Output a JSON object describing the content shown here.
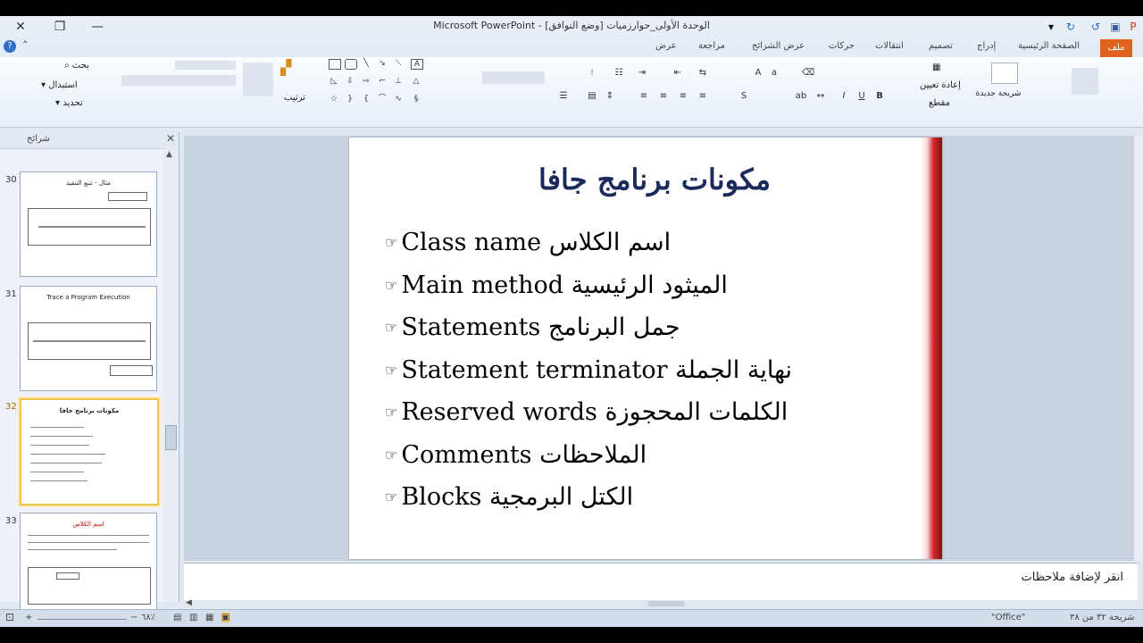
{
  "window": {
    "title": "Microsoft PowerPoint - [وضع التوافق] الوحدة الأولى_حوارزميات"
  },
  "ribbon": {
    "tabs": [
      "ملف",
      "الصفحة الرئيسية",
      "إدراج",
      "تصميم",
      "انتقالات",
      "حركات",
      "عرض الشرائح",
      "مراجعة",
      "عرض"
    ],
    "editing": {
      "find": "بحث",
      "replace": "استبدال",
      "select": "تحديد"
    },
    "arrange": "ترتيب",
    "slides": {
      "new_slide": "شريحة جديدة",
      "reset": "إعادة تعيين",
      "section": "مقطع"
    }
  },
  "slide_pane": {
    "header": "شرائح",
    "thumbnails": [
      {
        "number": "30",
        "title": "مثال - تتبع التنفيذ",
        "selected": false
      },
      {
        "number": "31",
        "title": "Trace a Program Execution",
        "selected": false
      },
      {
        "number": "32",
        "title": "مكونات برنامج جافا",
        "selected": true
      },
      {
        "number": "33",
        "title": "اسم الكلاس",
        "selected": false
      }
    ]
  },
  "slide": {
    "title": "مكونات برنامج جافا",
    "bullet_icon": "pointing-hand-icon",
    "bullets": [
      {
        "en": "Class name",
        "ar": "اسم الكلاس"
      },
      {
        "en": "Main method",
        "ar": "الميثود الرئيسية"
      },
      {
        "en": "Statements",
        "ar": "جمل البرنامج"
      },
      {
        "en": "Statement terminator",
        "ar": "نهاية الجملة"
      },
      {
        "en": "Reserved words",
        "ar": "الكلمات المحجوزة"
      },
      {
        "en": "Comments",
        "ar": "الملاحظات"
      },
      {
        "en": "Blocks",
        "ar": "الكتل البرمجية"
      }
    ],
    "accent_color": "#d8242a"
  },
  "notes": {
    "placeholder": "انقر لإضافة ملاحظات"
  },
  "status": {
    "slide_info": "شريحة ٣٢ من ٣٨",
    "theme": "\"Office\"",
    "zoom": "٦٨٪"
  }
}
